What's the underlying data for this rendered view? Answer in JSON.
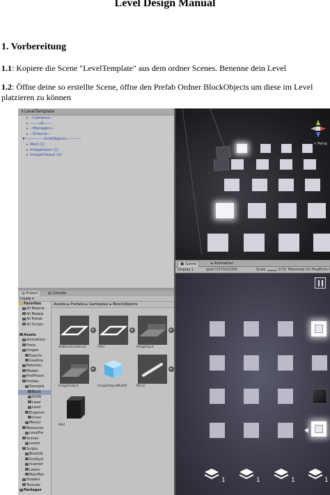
{
  "document": {
    "title": "Level Design Manual",
    "section_heading": "1. Vorbereitung",
    "steps": [
      {
        "number": "1.1",
        "text": ": Kopiere die Scene \"LevelTemplate\" aus dem ordner Scenes. Benenne dein Level"
      },
      {
        "number": "1.2",
        "text": ": Öffne deine so erstellte Scene, öffne den Prefab Ordner BlockObjects um diese im Level platzieren zu können"
      }
    ]
  },
  "hierarchy": {
    "root": "LevelTemplate",
    "rows": [
      {
        "label": "--Cameras--",
        "indent": 1
      },
      {
        "label": "-------UI------",
        "indent": 1
      },
      {
        "label": "--Managers--",
        "indent": 1
      },
      {
        "label": "--Ground---",
        "indent": 1
      },
      {
        "label": "-------------GridObjects-----------",
        "indent": 0
      },
      {
        "label": "Wall (1)",
        "indent": 1
      },
      {
        "label": "ImageInput (1)",
        "indent": 1
      },
      {
        "label": "ImageOutput (1)",
        "indent": 1
      }
    ]
  },
  "scene": {
    "persp_label": "< Persp"
  },
  "game_view": {
    "tabs": [
      "Game",
      "Animation"
    ],
    "display": "Display 1",
    "resolution": "ipad (1573x2100)",
    "scale_label": "Scale",
    "scale_value": "0.32",
    "maximize": "Maximize On Play",
    "mute": "Mute Au",
    "layer_counts": [
      "1",
      "1",
      "1",
      "1"
    ]
  },
  "project": {
    "tabs": [
      "Project",
      "Console"
    ],
    "create_label": "Create",
    "breadcrumb": "Assets  ▸  Prefabs  ▸  Gameplay  ▸  BlockObjects",
    "tree": [
      {
        "label": "Favorites",
        "bold": true,
        "indent": 0
      },
      {
        "label": "All Materia",
        "indent": 1
      },
      {
        "label": "All Models",
        "indent": 1
      },
      {
        "label": "All Prefab",
        "indent": 1
      },
      {
        "label": "All Scripts",
        "indent": 1
      },
      {
        "label": "",
        "indent": 0
      },
      {
        "label": "Assets",
        "bold": true,
        "indent": 0
      },
      {
        "label": "Animations",
        "indent": 1
      },
      {
        "label": "Fonts",
        "indent": 1
      },
      {
        "label": "Images",
        "indent": 1
      },
      {
        "label": "Exports",
        "indent": 2
      },
      {
        "label": "GoalIma",
        "indent": 2
      },
      {
        "label": "Materials",
        "indent": 1
      },
      {
        "label": "Models",
        "indent": 1
      },
      {
        "label": "PostProces",
        "indent": 1
      },
      {
        "label": "Prefabs",
        "indent": 1
      },
      {
        "label": "Gamepla",
        "indent": 2
      },
      {
        "label": "Block",
        "indent": 3,
        "selected": true
      },
      {
        "label": "GridS",
        "indent": 3
      },
      {
        "label": "Laser",
        "indent": 3
      },
      {
        "label": "Level",
        "indent": 3
      },
      {
        "label": "Engamet",
        "indent": 2
      },
      {
        "label": "Inven",
        "indent": 3
      },
      {
        "label": "MenuU",
        "indent": 2
      },
      {
        "label": "Resources",
        "indent": 1
      },
      {
        "label": "LevelPre",
        "indent": 2
      },
      {
        "label": "Scenes",
        "indent": 1
      },
      {
        "label": "Levels",
        "indent": 2
      },
      {
        "label": "Scripts",
        "indent": 1
      },
      {
        "label": "BlockOb",
        "indent": 2
      },
      {
        "label": "GridSyst",
        "indent": 2
      },
      {
        "label": "Inventor",
        "indent": 2
      },
      {
        "label": "Lasers",
        "indent": 2
      },
      {
        "label": "MainMen",
        "indent": 2
      },
      {
        "label": "Shaders",
        "indent": 1
      },
      {
        "label": "Textures",
        "indent": 1
      },
      {
        "label": "Packages",
        "bold": true,
        "indent": 0
      }
    ],
    "assets": [
      {
        "label": "AdditiveCombine3"
      },
      {
        "label": "Filter"
      },
      {
        "label": "ImageInput"
      },
      {
        "label": "ImageOutput"
      },
      {
        "label": "ImageOutputMultiD"
      },
      {
        "label": "Mirror"
      },
      {
        "label": "Wall"
      }
    ]
  }
}
